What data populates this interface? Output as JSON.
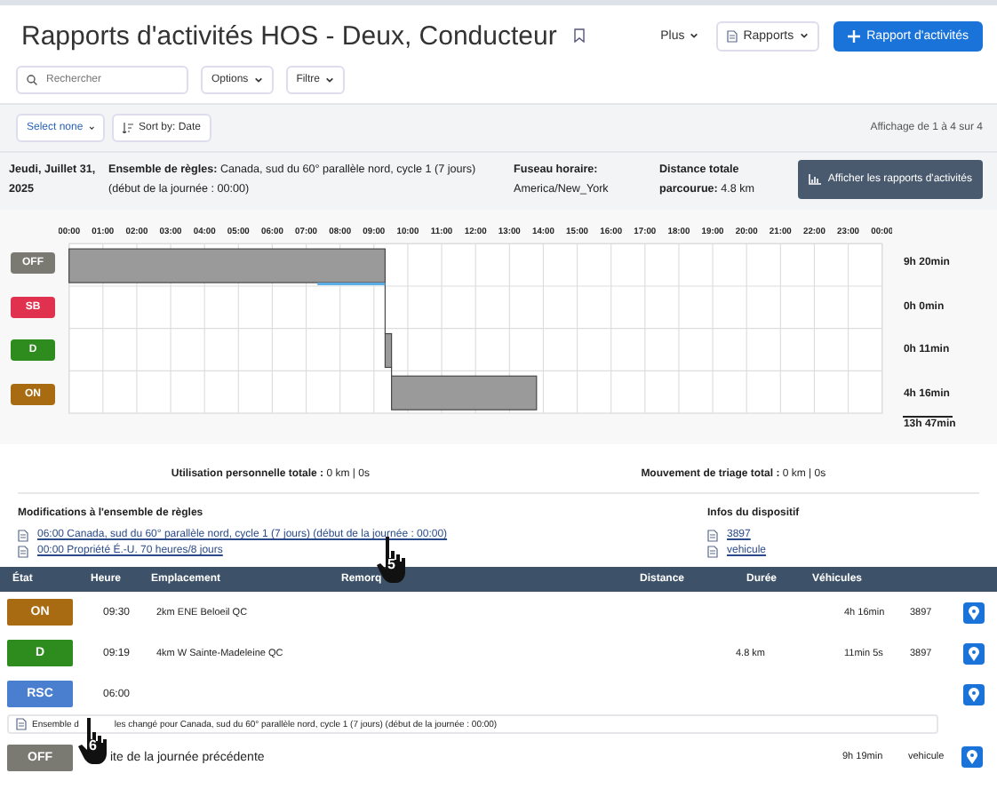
{
  "header": {
    "title": "Rapports d'activités HOS - Deux, Conducteur",
    "more_button": "Plus",
    "reports_button": "Rapports",
    "add_button": "Rapport d'activités"
  },
  "toolbar": {
    "search_placeholder": "Rechercher",
    "options": "Options",
    "filter": "Filtre"
  },
  "list_bar": {
    "select": "Select none",
    "sort": "Sort by: Date",
    "count": "Affichage de 1 à 4 sur 4"
  },
  "day": {
    "date": "Jeudi, Juillet 31, 2025",
    "ruleset_label": "Ensemble de règles:",
    "ruleset": "Canada, sud du 60° parallèle nord, cycle 1 (7 jours) (début de la journée : 00:00)",
    "timezone_label": "Fuseau horaire:",
    "timezone": "America/New_York",
    "distance_label": "Distance totale parcourue:",
    "distance": "4.8 km",
    "view_button": "Afficher les rapports d'activités"
  },
  "chart": {
    "hours": [
      "00:00",
      "01:00",
      "02:00",
      "03:00",
      "04:00",
      "05:00",
      "06:00",
      "07:00",
      "08:00",
      "09:00",
      "10:00",
      "11:00",
      "12:00",
      "13:00",
      "14:00",
      "15:00",
      "16:00",
      "17:00",
      "18:00",
      "19:00",
      "20:00",
      "21:00",
      "22:00",
      "23:00",
      "00:00"
    ],
    "rows": [
      {
        "status": "OFF",
        "color": "#7a7a72",
        "total": "9h 20min"
      },
      {
        "status": "SB",
        "color": "#e0314f",
        "total": "0h 0min"
      },
      {
        "status": "D",
        "color": "#2e8b1e",
        "total": "0h 11min"
      },
      {
        "status": "ON",
        "color": "#a86b12",
        "total": "4h 16min"
      }
    ],
    "grand_total": "13h 47min"
  },
  "totals": [
    {
      "label": "Utilisation personnelle totale :",
      "value": "0 km | 0s"
    },
    {
      "label": "Mouvement de triage total :",
      "value": "0 km | 0s"
    }
  ],
  "rule_changes": {
    "title": "Modifications à l'ensemble de règles",
    "links": [
      "06:00 Canada, sud du 60° parallèle nord, cycle 1 (7 jours) (début de la journée : 00:00)",
      "00:00 Propriété É.-U. 70 heures/8 jours"
    ]
  },
  "device": {
    "title": "Infos du dispositif",
    "links": [
      "3897",
      "vehicule"
    ]
  },
  "table": {
    "columns": [
      "État",
      "Heure",
      "Emplacement",
      "Remorq",
      "Distance",
      "Durée",
      "Véhicules"
    ],
    "rows": [
      {
        "kind": "event",
        "status": "ON",
        "color": "#a86b12",
        "time": "09:30",
        "location": "2km ENE Beloeil QC",
        "distance": "",
        "duration": "4h 16min",
        "vehicle": "3897"
      },
      {
        "kind": "event",
        "status": "D",
        "color": "#2e8b1e",
        "time": "09:19",
        "location": "4km W Sainte-Madeleine QC",
        "distance": "4.8 km",
        "duration": "11min 5s",
        "vehicle": "3897"
      },
      {
        "kind": "event",
        "status": "RSC",
        "color": "#4a7fd0",
        "time": "06:00",
        "location": "",
        "distance": "",
        "duration": "",
        "vehicle": ""
      },
      {
        "kind": "note",
        "before": "Ensemble d",
        "after": "les changé pour Canada, sud du 60° parallèle nord, cycle 1 (7 jours) (début de la journée : 00:00)"
      },
      {
        "kind": "previous",
        "status": "OFF",
        "color": "#7a7a72",
        "label": "ite de la journée précédente",
        "duration": "9h 19min",
        "vehicle": "vehicule"
      }
    ]
  },
  "cursors": [
    "5",
    "6"
  ]
}
